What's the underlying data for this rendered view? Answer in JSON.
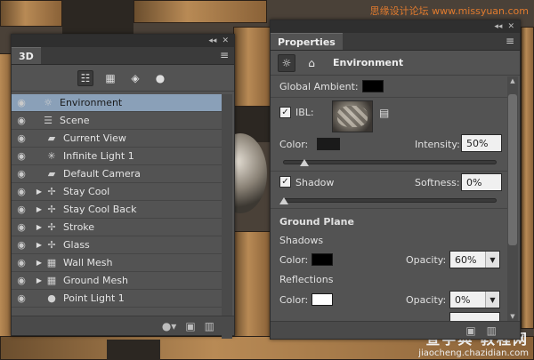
{
  "watermark": {
    "top": "思缘设计论坛 www.missyuan.com",
    "bottom_big": "查字典 教程网",
    "bottom_small": "jiaocheng.chazidian.com"
  },
  "panel3d": {
    "tab": "3D",
    "collapse": "◂◂",
    "close": "✕",
    "menu": "≡",
    "layers": [
      {
        "name": "Environment",
        "icon": "environment-icon",
        "glyph": "☼",
        "expand": "",
        "eye": "◉",
        "selected": true
      },
      {
        "name": "Scene",
        "icon": "scene-icon",
        "glyph": "☰",
        "expand": "",
        "eye": "◉"
      },
      {
        "name": "Current View",
        "icon": "camera-icon",
        "glyph": "▰",
        "expand": "",
        "eye": "◉",
        "indent": true
      },
      {
        "name": "Infinite Light 1",
        "icon": "infinite-light-icon",
        "glyph": "✳",
        "expand": "",
        "eye": "◉",
        "indent": true
      },
      {
        "name": "Default Camera",
        "icon": "camera-icon",
        "glyph": "▰",
        "expand": "",
        "eye": "◉",
        "indent": true
      },
      {
        "name": "Stay  Cool",
        "icon": "mesh-icon",
        "glyph": "✢",
        "expand": "▶",
        "eye": "◉",
        "indent": true
      },
      {
        "name": "Stay  Cool Back",
        "icon": "mesh-icon",
        "glyph": "✢",
        "expand": "▶",
        "eye": "◉",
        "indent": true
      },
      {
        "name": "Stroke",
        "icon": "mesh-icon",
        "glyph": "✢",
        "expand": "▶",
        "eye": "◉",
        "indent": true
      },
      {
        "name": "Glass",
        "icon": "mesh-icon",
        "glyph": "✢",
        "expand": "▶",
        "eye": "◉",
        "indent": true
      },
      {
        "name": "Wall Mesh",
        "icon": "wall-mesh-icon",
        "glyph": "▦",
        "expand": "▶",
        "eye": "◉",
        "indent": true
      },
      {
        "name": "Ground Mesh",
        "icon": "ground-mesh-icon",
        "glyph": "▦",
        "expand": "▶",
        "eye": "◉",
        "indent": true
      },
      {
        "name": "Point Light 1",
        "icon": "point-light-icon",
        "glyph": "●",
        "expand": "",
        "eye": "◉",
        "indent": true
      }
    ],
    "footer_icons": [
      "light-bulb-icon",
      "new-scene-icon",
      "trash-icon"
    ]
  },
  "properties": {
    "tab": "Properties",
    "collapse": "◂◂",
    "close": "✕",
    "menu": "≡",
    "title": "Environment",
    "global_ambient_label": "Global Ambient:",
    "global_ambient_color": "#000000",
    "ibl_label": "IBL:",
    "ibl_checked": "✓",
    "color_label": "Color:",
    "color_value": "#1a1a1a",
    "intensity_label": "Intensity:",
    "intensity_value": "50%",
    "intensity_level": 0.1,
    "shadow_label": "Shadow",
    "shadow_checked": "✓",
    "softness_label": "Softness:",
    "softness_value": "0%",
    "ground_plane_label": "Ground Plane",
    "shadows_label": "Shadows",
    "shadows_color_label": "Color:",
    "shadows_color": "#000000",
    "shadows_opacity_label": "Opacity:",
    "shadows_opacity": "60%",
    "reflections_label": "Reflections",
    "reflections_color_label": "Color:",
    "reflections_color": "#ffffff",
    "reflections_opacity_label": "Opacity:",
    "reflections_opacity": "0%"
  }
}
